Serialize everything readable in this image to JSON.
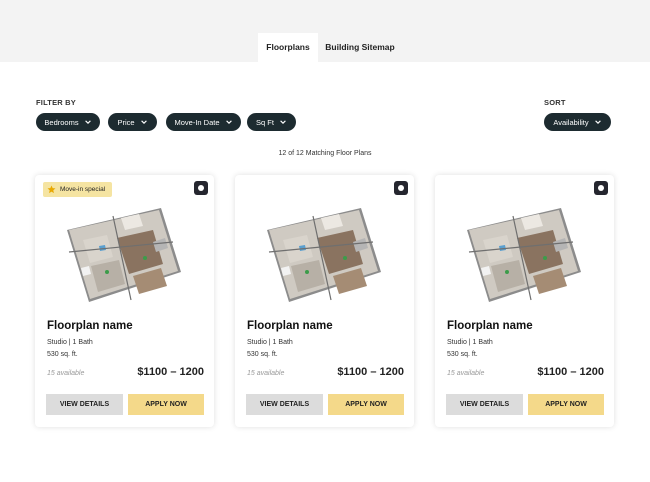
{
  "tabs": [
    {
      "label": "Floorplans"
    },
    {
      "label": "Building Sitemap"
    }
  ],
  "filter_label": "FILTER BY",
  "sort_label": "SORT",
  "filters": [
    {
      "label": "Bedrooms"
    },
    {
      "label": "Price"
    },
    {
      "label": "Move-In Date"
    },
    {
      "label": "Sq Ft"
    }
  ],
  "sort": {
    "label": "Availability"
  },
  "match_count": "12 of 12 Matching Floor Plans",
  "cards": [
    {
      "badge": "Move-in special",
      "name": "Floorplan name",
      "beds": "Studio | 1 Bath",
      "sqft": "530 sq. ft.",
      "available": "15 available",
      "price": "$1100 – 1200",
      "details_label": "VIEW DETAILS",
      "apply_label": "APPLY NOW"
    },
    {
      "name": "Floorplan name",
      "beds": "Studio | 1 Bath",
      "sqft": "530 sq. ft.",
      "available": "15 available",
      "price": "$1100 – 1200",
      "details_label": "VIEW DETAILS",
      "apply_label": "APPLY NOW"
    },
    {
      "name": "Floorplan name",
      "beds": "Studio | 1 Bath",
      "sqft": "530 sq. ft.",
      "available": "15 available",
      "price": "$1100 – 1200",
      "details_label": "VIEW DETAILS",
      "apply_label": "APPLY NOW"
    }
  ],
  "icons": {
    "badge": "star-icon",
    "tour": "virtual-tour-icon",
    "dropdown": "chevron-down-icon"
  },
  "colors": {
    "pill": "#1d2b30",
    "badge": "#f5e4a2",
    "apply": "#f4d98a",
    "details": "#dcdcdc"
  }
}
